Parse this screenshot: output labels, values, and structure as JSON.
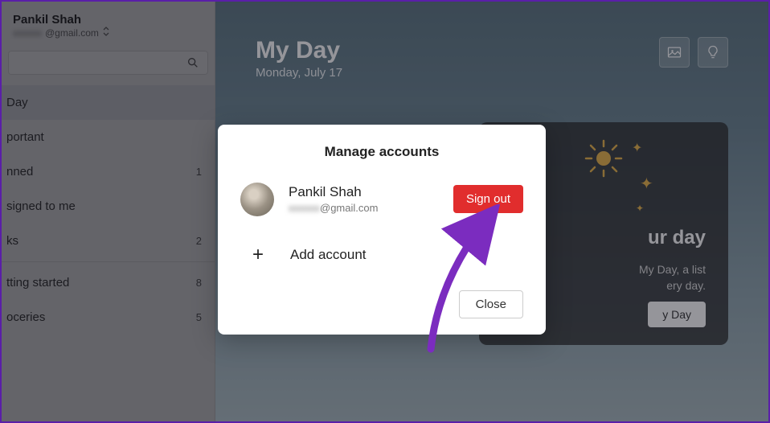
{
  "user": {
    "name": "Pankil Shah",
    "email_hidden": "xxxxxx",
    "email_suffix": "@gmail.com"
  },
  "search": {
    "placeholder": ""
  },
  "nav": {
    "items": [
      {
        "label": "Day",
        "badge": "",
        "selected": true
      },
      {
        "label": "portant",
        "badge": ""
      },
      {
        "label": "nned",
        "badge": "1"
      },
      {
        "label": "signed to me",
        "badge": ""
      },
      {
        "label": "ks",
        "badge": "2"
      }
    ],
    "items2": [
      {
        "label": "tting started",
        "badge": "8"
      },
      {
        "label": "oceries",
        "badge": "5"
      }
    ]
  },
  "header": {
    "title": "My Day",
    "date": "Monday, July 17"
  },
  "focus_card": {
    "title": "ur day",
    "line1": "My Day, a list",
    "line2": "ery day.",
    "button": "y Day"
  },
  "modal": {
    "title": "Manage accounts",
    "account_name": "Pankil Shah",
    "account_email_suffix": "@gmail.com",
    "signout": "Sign out",
    "add": "Add account",
    "close": "Close"
  },
  "colors": {
    "signout_bg": "#e12d2d",
    "arrow": "#7b2cbf"
  }
}
